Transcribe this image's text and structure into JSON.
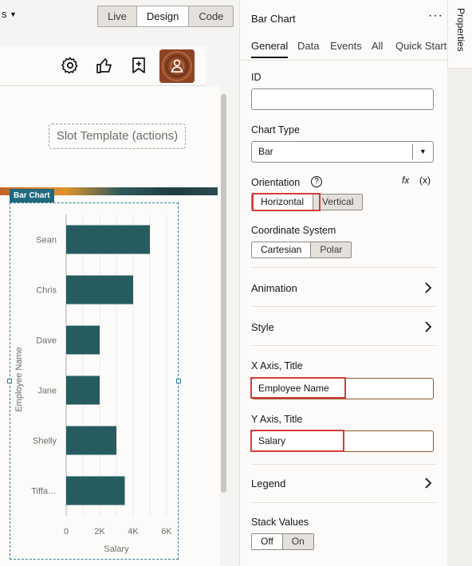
{
  "topbar": {
    "dropdown_label": "s",
    "modes": [
      "Live",
      "Design",
      "Code"
    ],
    "active_mode": "Design"
  },
  "toolbar": {
    "icons": [
      "settings-icon",
      "thumbs-up-icon",
      "bookmark-add-icon"
    ],
    "avatar": "user-avatar-icon"
  },
  "canvas": {
    "slot_label": "Slot Template (actions)",
    "chart_tag": "Bar Chart"
  },
  "chart_data": {
    "type": "bar",
    "orientation": "horizontal",
    "categories": [
      "Sean",
      "Chris",
      "Dave",
      "Jane",
      "Shelly",
      "Tiffa…"
    ],
    "values": [
      5000,
      4000,
      2000,
      2000,
      3000,
      3500
    ],
    "xlabel": "Salary",
    "ylabel": "Employee Name",
    "xlim": [
      0,
      6000
    ],
    "x_ticks": [
      "0",
      "2K",
      "4K",
      "6K"
    ],
    "grid": true,
    "bar_color": "#265c5f"
  },
  "panel": {
    "title": "Bar Chart",
    "more": "···",
    "tabs": [
      "General",
      "Data",
      "Events",
      "All",
      "Quick Start"
    ],
    "active_tab": "General",
    "id_label": "ID",
    "id_value": "",
    "chart_type_label": "Chart Type",
    "chart_type_value": "Bar",
    "orientation_label": "Orientation",
    "orientation_options": [
      "Horizontal",
      "Vertical"
    ],
    "orientation_selected": "Horizontal",
    "fx_label": "fx",
    "var_label": "(x)",
    "coord_label": "Coordinate System",
    "coord_options": [
      "Cartesian",
      "Polar"
    ],
    "coord_selected": "Cartesian",
    "animation_label": "Animation",
    "style_label": "Style",
    "x_axis_title_label": "X Axis, Title",
    "x_axis_title_value": "Employee Name",
    "y_axis_title_label": "Y Axis, Title",
    "y_axis_title_value": "Salary",
    "legend_label": "Legend",
    "stack_label": "Stack Values",
    "stack_options": [
      "Off",
      "On"
    ],
    "stack_selected": "Off",
    "highlight_color": "#d63b3b"
  },
  "right_tab": {
    "label": "Properties"
  }
}
